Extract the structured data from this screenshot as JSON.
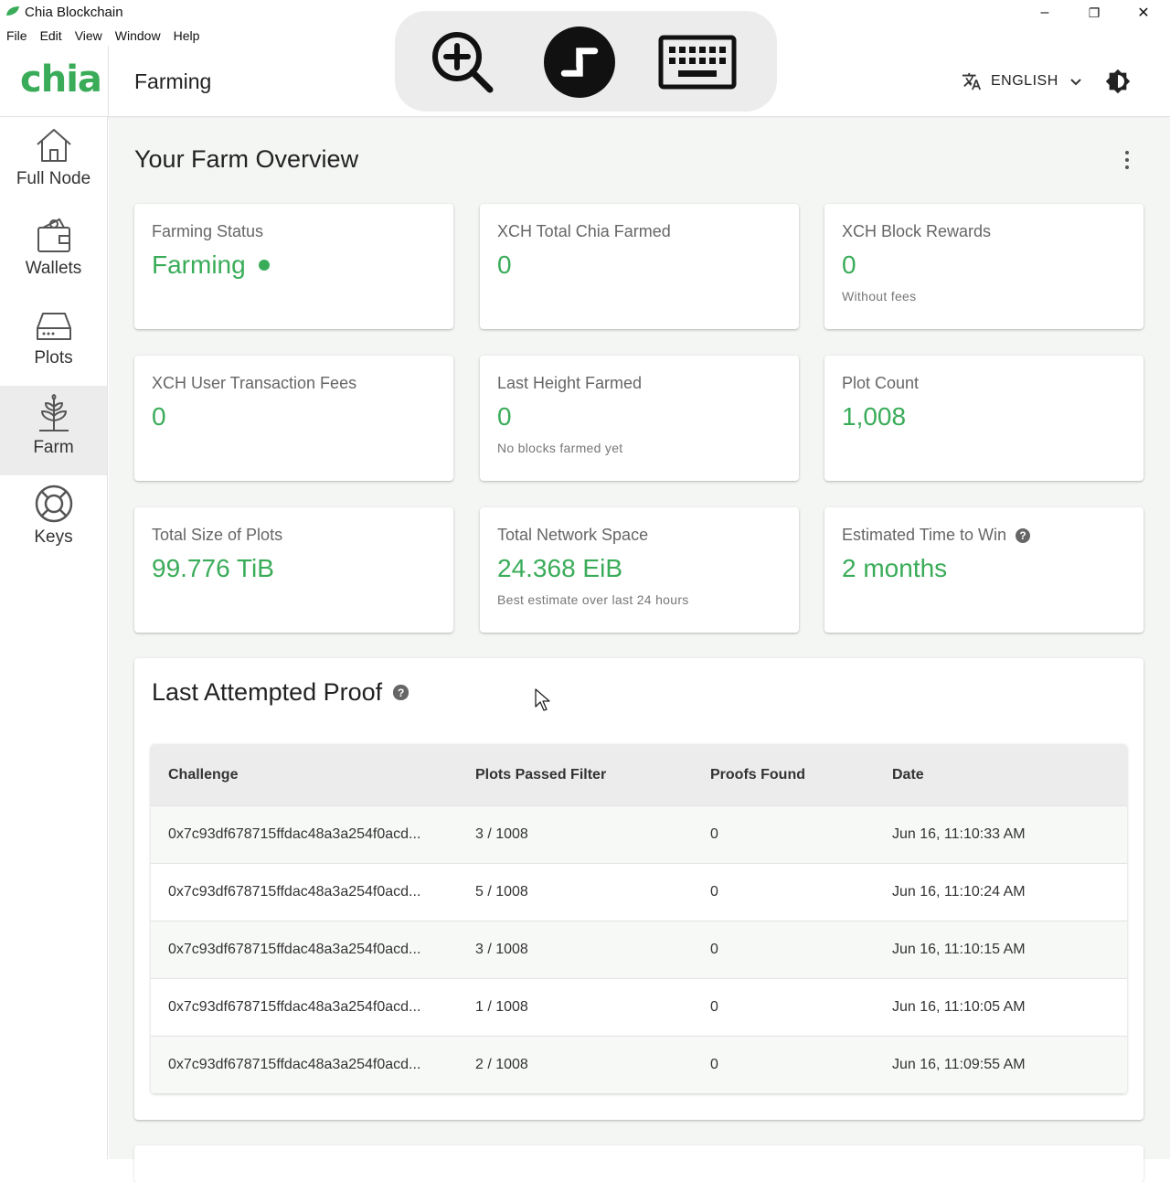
{
  "window": {
    "title": "Chia Blockchain",
    "minimize": "–",
    "restore": "❐",
    "close": "✕"
  },
  "menu": [
    "File",
    "Edit",
    "View",
    "Window",
    "Help"
  ],
  "header": {
    "logo": "chia",
    "page_title": "Farming",
    "language": "ENGLISH"
  },
  "sidebar": {
    "items": [
      {
        "label": "Full Node",
        "icon": "home-icon"
      },
      {
        "label": "Wallets",
        "icon": "wallet-icon"
      },
      {
        "label": "Plots",
        "icon": "hard-drive-icon"
      },
      {
        "label": "Farm",
        "icon": "farm-plant-icon",
        "active": true
      },
      {
        "label": "Keys",
        "icon": "lifebuoy-icon"
      }
    ]
  },
  "overview": {
    "title": "Your Farm Overview",
    "cards": [
      {
        "title": "Farming Status",
        "value": "Farming",
        "subtitle": ""
      },
      {
        "title": "XCH Total Chia Farmed",
        "value": "0",
        "subtitle": ""
      },
      {
        "title": "XCH Block Rewards",
        "value": "0",
        "subtitle": "Without fees"
      },
      {
        "title": "XCH User Transaction Fees",
        "value": "0",
        "subtitle": ""
      },
      {
        "title": "Last Height Farmed",
        "value": "0",
        "subtitle": "No blocks farmed yet"
      },
      {
        "title": "Plot Count",
        "value": "1,008",
        "subtitle": ""
      },
      {
        "title": "Total Size of Plots",
        "value": "99.776 TiB",
        "subtitle": ""
      },
      {
        "title": "Total Network Space",
        "value": "24.368 EiB",
        "subtitle": "Best estimate over last 24 hours"
      },
      {
        "title": "Estimated Time to Win",
        "value": "2 months",
        "subtitle": ""
      }
    ]
  },
  "proof": {
    "title": "Last Attempted Proof",
    "columns": [
      "Challenge",
      "Plots Passed Filter",
      "Proofs Found",
      "Date"
    ],
    "rows": [
      [
        "0x7c93df678715ffdac48a3a254f0acd...",
        "3 / 1008",
        "0",
        "Jun 16, 11:10:33 AM"
      ],
      [
        "0x7c93df678715ffdac48a3a254f0acd...",
        "5 / 1008",
        "0",
        "Jun 16, 11:10:24 AM"
      ],
      [
        "0x7c93df678715ffdac48a3a254f0acd...",
        "3 / 1008",
        "0",
        "Jun 16, 11:10:15 AM"
      ],
      [
        "0x7c93df678715ffdac48a3a254f0acd...",
        "1 / 1008",
        "0",
        "Jun 16, 11:10:05 AM"
      ],
      [
        "0x7c93df678715ffdac48a3a254f0acd...",
        "2 / 1008",
        "0",
        "Jun 16, 11:09:55 AM"
      ]
    ]
  },
  "colors": {
    "accent": "#3aac59",
    "active_nav": "#ececec"
  }
}
